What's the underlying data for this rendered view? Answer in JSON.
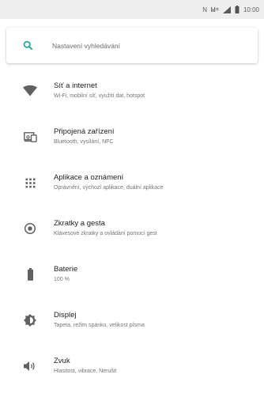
{
  "status_bar": {
    "icons": [
      "nfc-icon",
      "data-4g-icon",
      "signal-icon",
      "battery-icon"
    ],
    "nfc_text": "N",
    "time": "10:00"
  },
  "search": {
    "placeholder": "Nastavení vyhledávání",
    "accent_color": "#26a69a"
  },
  "settings": [
    {
      "title": "Síť a internet",
      "subtitle": "Wi-Fi, mobilní síť, využití dat, hotspot",
      "icon": "wifi-icon"
    },
    {
      "title": "Připojená zařízení",
      "subtitle": "Bluetooth, vysílání, NFC",
      "icon": "connected-devices-icon"
    },
    {
      "title": "Aplikace a oznámení",
      "subtitle": "Oprávnění, výchozí aplikace, duální aplikace",
      "icon": "apps-icon"
    },
    {
      "title": "Zkratky a gesta",
      "subtitle": "Klávesové zkratky a ovládání pomocí gest",
      "icon": "gestures-icon"
    },
    {
      "title": "Baterie",
      "subtitle": "100 %",
      "icon": "battery-icon"
    },
    {
      "title": "Displej",
      "subtitle": "Tapeta, režim spánku, velikost písma",
      "icon": "brightness-icon"
    },
    {
      "title": "Zvuk",
      "subtitle": "Hlasitost, vibrace, Nerušit",
      "icon": "volume-icon"
    }
  ],
  "colors": {
    "icon_gray": "#616161",
    "status_bar_bg": "#eeeeee"
  }
}
